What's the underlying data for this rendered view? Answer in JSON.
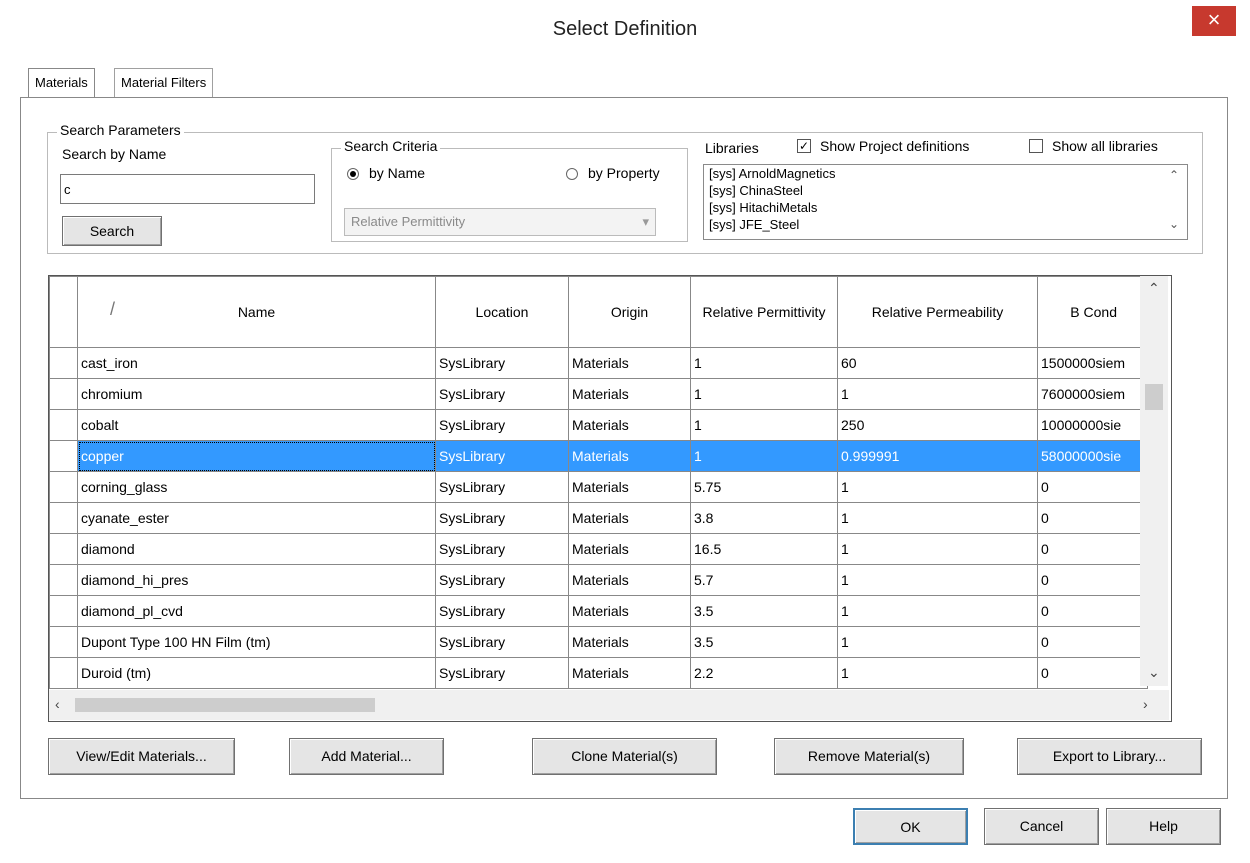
{
  "window": {
    "title": "Select Definition",
    "close_glyph": "×"
  },
  "tabs": [
    {
      "label": "Materials"
    },
    {
      "label": "Material Filters"
    }
  ],
  "search_params": {
    "legend": "Search Parameters",
    "by_name_label": "Search by Name",
    "name_value": "c",
    "search_button": "Search"
  },
  "search_criteria": {
    "legend": "Search Criteria",
    "by_name": "by Name",
    "by_property": "by Property",
    "selected": "by Name",
    "property_select": "Relative Permittivity"
  },
  "libraries": {
    "label": "Libraries",
    "show_project_label": "Show Project definitions",
    "show_project_checked": true,
    "show_all_label": "Show all libraries",
    "show_all_checked": false,
    "items": [
      "[sys] ArnoldMagnetics",
      "[sys] ChinaSteel",
      "[sys] HitachiMetals",
      "[sys] JFE_Steel"
    ]
  },
  "table": {
    "columns": [
      "Name",
      "Location",
      "Origin",
      "Relative Permittivity",
      "Relative Permeability",
      "B Cond"
    ],
    "rows": [
      [
        "cast_iron",
        "SysLibrary",
        "Materials",
        "1",
        "60",
        "1500000siem"
      ],
      [
        "chromium",
        "SysLibrary",
        "Materials",
        "1",
        "1",
        "7600000siem"
      ],
      [
        "cobalt",
        "SysLibrary",
        "Materials",
        "1",
        "250",
        "10000000sie"
      ],
      [
        "copper",
        "SysLibrary",
        "Materials",
        "1",
        "0.999991",
        "58000000sie"
      ],
      [
        "corning_glass",
        "SysLibrary",
        "Materials",
        "5.75",
        "1",
        "0"
      ],
      [
        "cyanate_ester",
        "SysLibrary",
        "Materials",
        "3.8",
        "1",
        "0"
      ],
      [
        "diamond",
        "SysLibrary",
        "Materials",
        "16.5",
        "1",
        "0"
      ],
      [
        "diamond_hi_pres",
        "SysLibrary",
        "Materials",
        "5.7",
        "1",
        "0"
      ],
      [
        "diamond_pl_cvd",
        "SysLibrary",
        "Materials",
        "3.5",
        "1",
        "0"
      ],
      [
        "Dupont Type 100 HN Film (tm)",
        "SysLibrary",
        "Materials",
        "3.5",
        "1",
        "0"
      ],
      [
        "Duroid (tm)",
        "SysLibrary",
        "Materials",
        "2.2",
        "1",
        "0"
      ]
    ],
    "selected_row": "copper"
  },
  "actions": {
    "view_edit": "View/Edit Materials...",
    "add": "Add Material...",
    "clone": "Clone Material(s)",
    "remove": "Remove Material(s)",
    "export": "Export to Library..."
  },
  "footer": {
    "ok": "OK",
    "cancel": "Cancel",
    "help": "Help"
  }
}
